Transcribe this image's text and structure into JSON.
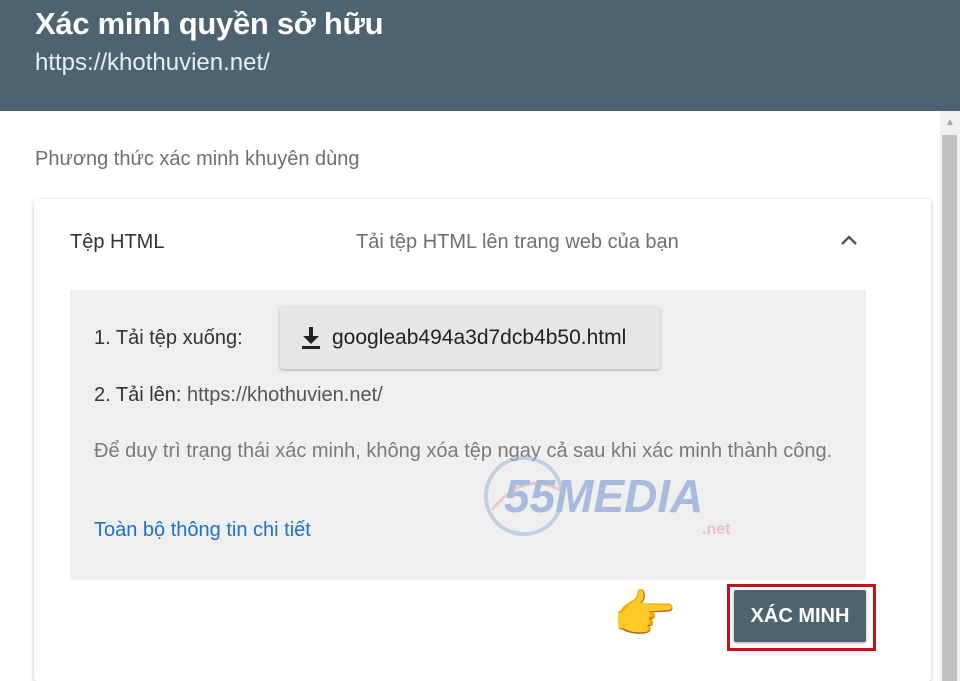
{
  "header": {
    "title": "Xác minh quyền sở hữu",
    "site_url": "https://khothuvien.net/"
  },
  "section": {
    "label": "Phương thức xác minh khuyên dùng"
  },
  "method": {
    "name": "Tệp HTML",
    "description": "Tải tệp HTML lên trang web của bạn",
    "expanded": true,
    "step1_label": "1. Tải tệp xuống:",
    "file_name": "googleab494a3d7dcb4b50.html",
    "step2_label": "2. Tải lên:",
    "step2_url": "https://khothuvien.net/",
    "note": "Để duy trì trạng thái xác minh, không xóa tệp ngay cả sau khi xác minh thành công.",
    "details_link": "Toàn bộ thông tin chi tiết",
    "verify_button": "XÁC MINH"
  },
  "watermark": {
    "brand": "55MEDIA",
    "suffix": ".net"
  },
  "annotation": {
    "pointer_icon": "👉",
    "highlight_color": "#c0141b"
  },
  "colors": {
    "header_bg": "#4d6470",
    "link": "#1a73c7",
    "panel_bg": "#efefef"
  }
}
